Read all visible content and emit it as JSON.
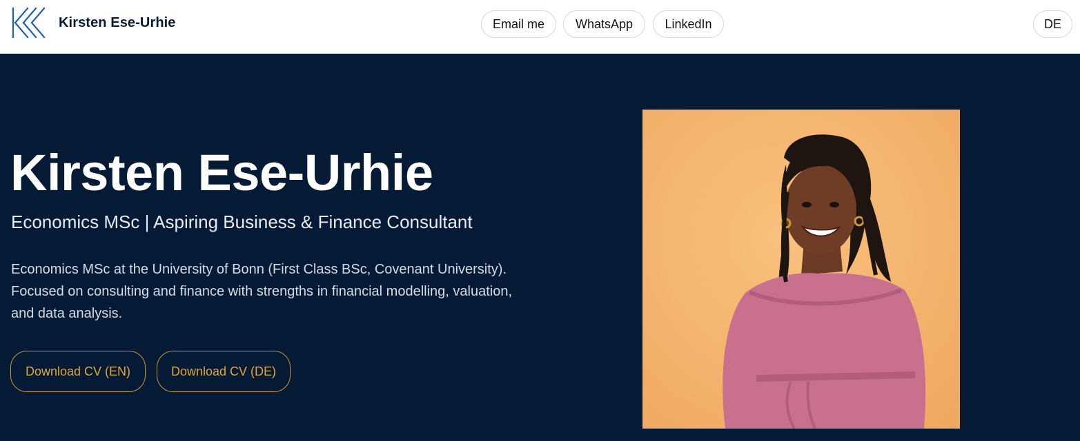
{
  "header": {
    "logo_icon": "kes-monogram-icon",
    "brand_name": "Kirsten Ese-Urhie",
    "nav": {
      "email": "Email me",
      "whatsapp": "WhatsApp",
      "linkedin": "LinkedIn"
    },
    "language_toggle": "DE"
  },
  "hero": {
    "title": "Kirsten Ese-Urhie",
    "subtitle": "Economics MSc | Aspiring Business & Finance Consultant",
    "description": "Economics MSc at the University of Bonn (First Class BSc, Covenant University). Focused on consulting and finance with strengths in financial modelling, valuation, and data analysis.",
    "buttons": {
      "cv_en": "Download CV (EN)",
      "cv_de": "Download CV (DE)"
    }
  },
  "colors": {
    "hero_background": "#051a35",
    "accent": "#e0a73a",
    "logo_blue": "#1f5fa8",
    "photo_background": "#f4b46e",
    "blouse_pink": "#c9708f"
  }
}
